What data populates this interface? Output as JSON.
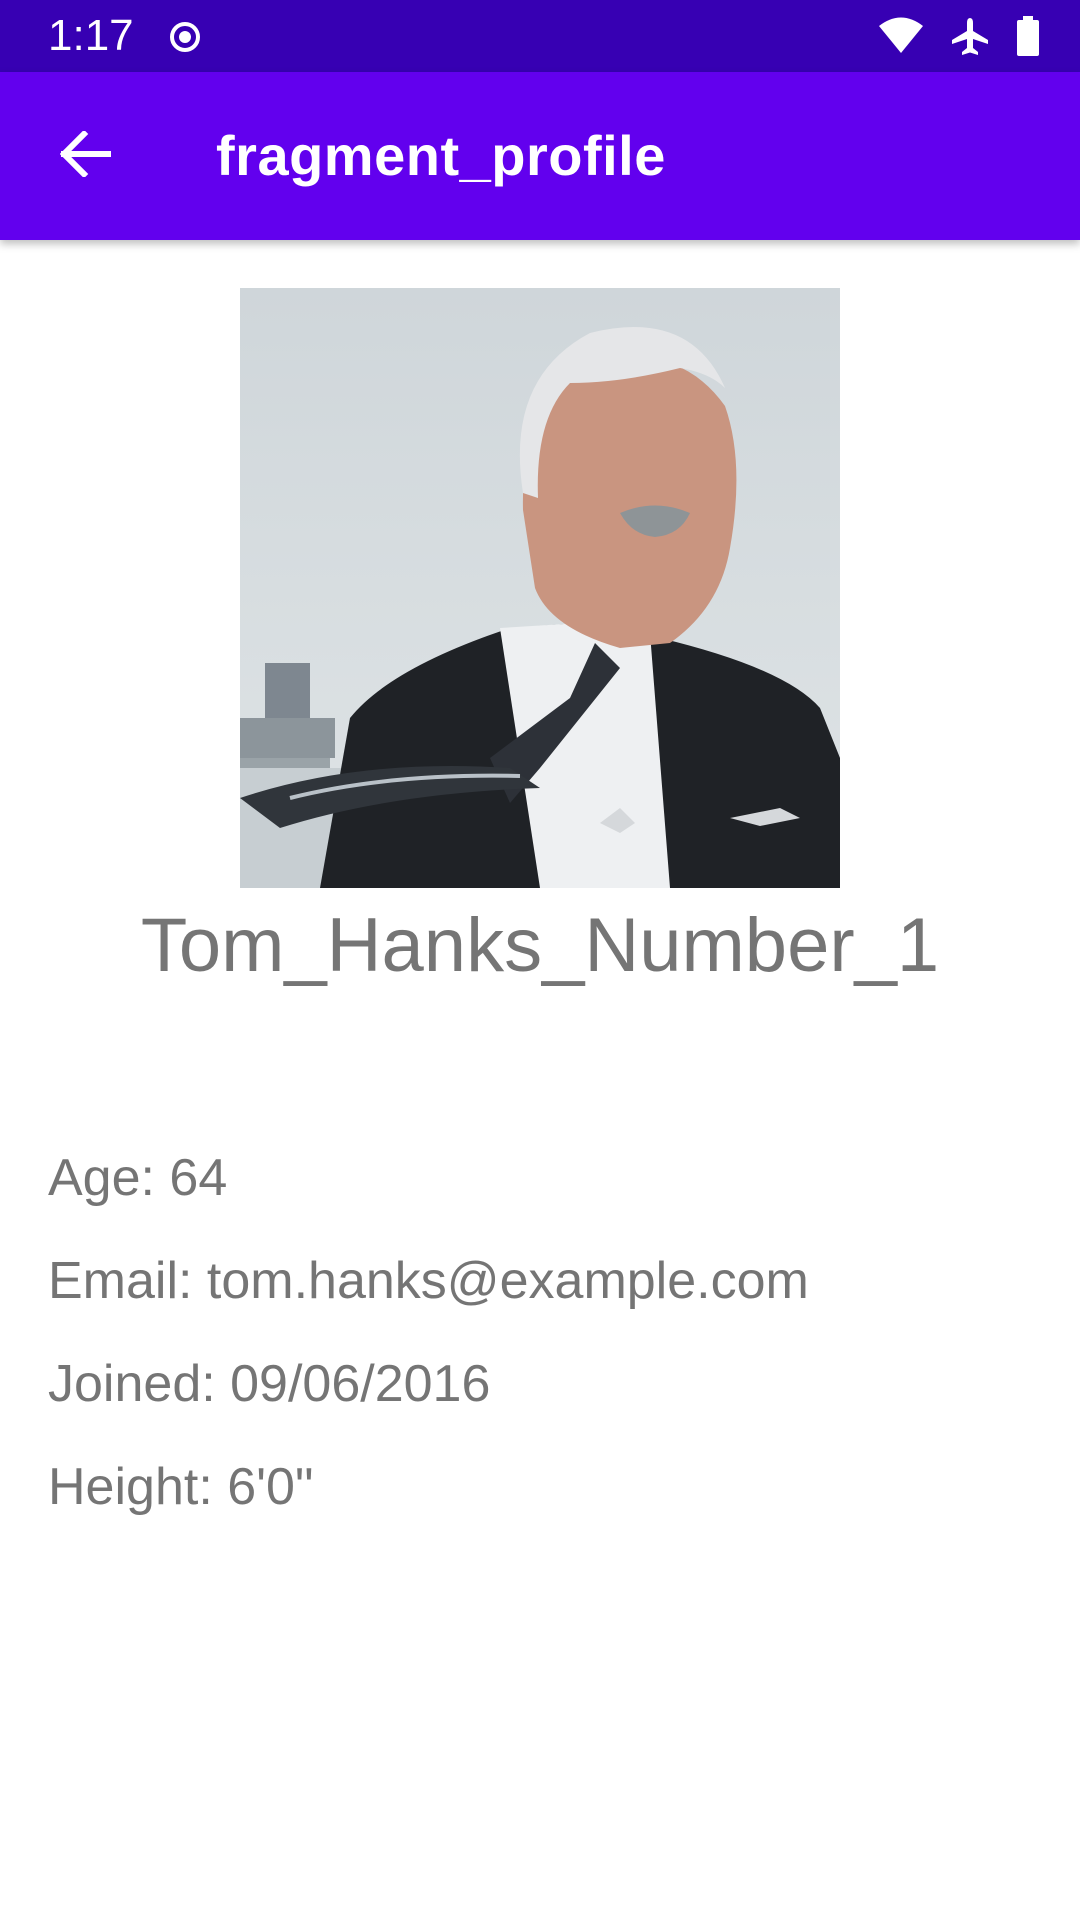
{
  "status_bar": {
    "time": "1:17",
    "left_icon": "radio-button-icon",
    "right_icons": [
      "wifi-icon",
      "airplane-mode-icon",
      "battery-icon"
    ]
  },
  "app_bar": {
    "title": "fragment_profile",
    "back_icon": "arrow-back-icon",
    "background_color": "#6200ee"
  },
  "profile": {
    "photo_icon": "profile-photo",
    "name": "Tom_Hanks_Number_1",
    "age": "Age: 64",
    "email": "Email: tom.hanks@example.com",
    "joined": "Joined: 09/06/2016",
    "height": "Height: 6'0\""
  },
  "colors": {
    "status_bar": "#3700b3",
    "primary": "#6200ee",
    "text_secondary": "#757575"
  }
}
